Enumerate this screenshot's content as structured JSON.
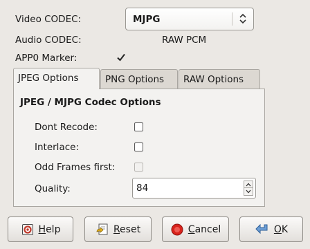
{
  "video_codec": {
    "label": "Video CODEC:",
    "value": "MJPG"
  },
  "audio_codec": {
    "label": "Audio CODEC:",
    "value": "RAW PCM"
  },
  "app0_marker": {
    "label": "APP0 Marker:",
    "checked": true
  },
  "tabs": [
    {
      "label": "JPEG Options",
      "active": true
    },
    {
      "label": "PNG Options",
      "active": false
    },
    {
      "label": "RAW Options",
      "active": false
    }
  ],
  "panel": {
    "title": "JPEG / MJPG Codec Options",
    "dont_recode": {
      "label": "Dont Recode:",
      "checked": false
    },
    "interlace": {
      "label": "Interlace:",
      "checked": false
    },
    "odd_frames_first": {
      "label": "Odd Frames first:",
      "checked": false,
      "disabled": true
    },
    "quality": {
      "label": "Quality:",
      "value": "84"
    }
  },
  "buttons": {
    "help": {
      "mnemonic": "H",
      "rest": "elp",
      "icon": "help-icon"
    },
    "reset": {
      "mnemonic": "R",
      "rest": "eset",
      "icon": "reset-icon"
    },
    "cancel": {
      "mnemonic": "C",
      "rest": "ancel",
      "icon": "cancel-icon"
    },
    "ok": {
      "mnemonic": "O",
      "rest": "K",
      "icon": "ok-icon"
    }
  }
}
